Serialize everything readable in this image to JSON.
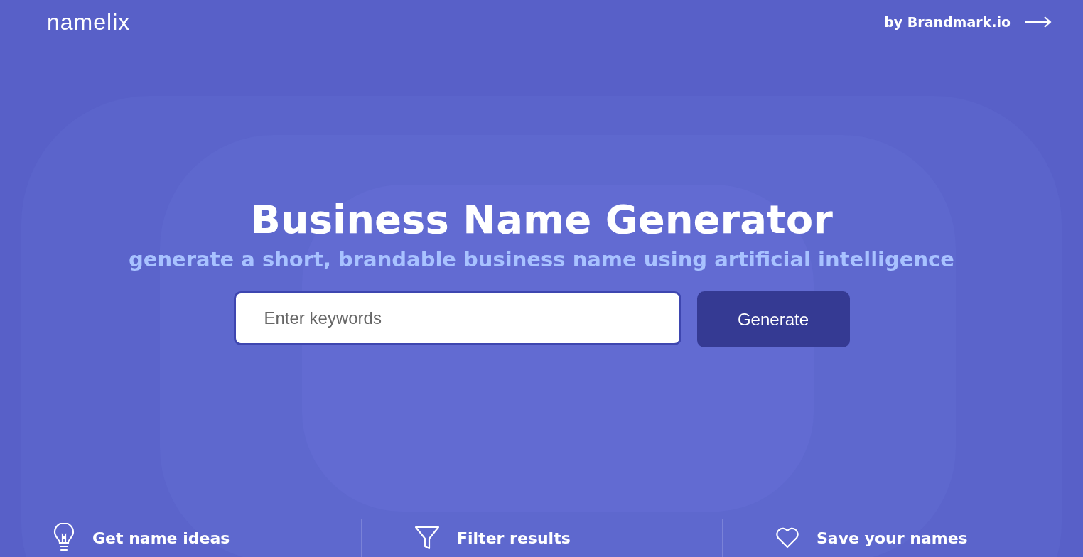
{
  "header": {
    "logo": "namelix",
    "link": "by Brandmark.io"
  },
  "hero": {
    "title": "Business Name Generator",
    "subtitle": "generate a short, brandable business name using artificial intelligence",
    "search": {
      "placeholder": "Enter keywords"
    },
    "button": "Generate"
  },
  "features": [
    {
      "kind": "bulb",
      "label": "Get name ideas"
    },
    {
      "kind": "filter",
      "label": "Filter results"
    },
    {
      "kind": "heart",
      "label": "Save your names"
    }
  ]
}
